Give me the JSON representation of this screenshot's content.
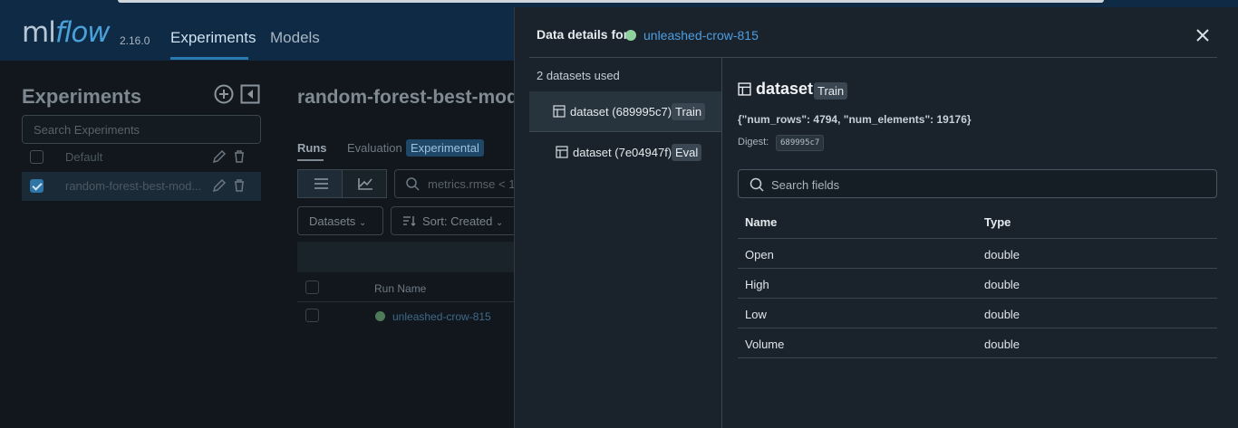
{
  "app": {
    "logo_ml": "ml",
    "logo_flow": "flow",
    "version": "2.16.0",
    "nav": [
      "Experiments",
      "Models"
    ]
  },
  "sidebar": {
    "title": "Experiments",
    "search_placeholder": "Search Experiments",
    "experiments": [
      {
        "name": "Default",
        "checked": false
      },
      {
        "name": "random-forest-best-mod...",
        "checked": true
      }
    ]
  },
  "main": {
    "title": "random-forest-best-mod",
    "tabs": [
      "Runs",
      "Evaluation"
    ],
    "experimental_badge": "Experimental",
    "search_text": "metrics.rmse < 1",
    "datasets_label": "Datasets",
    "sort_label": "Sort: Created",
    "column_run_name": "Run Name",
    "run_name": "unleashed-crow-815"
  },
  "drawer": {
    "header": "Data details for",
    "run_name": "unleashed-crow-815",
    "datasets_used": "2 datasets used",
    "datasets": [
      {
        "name": "dataset (689995c7)",
        "tag": "Train",
        "selected": true
      },
      {
        "name": "dataset (7e04947f)",
        "tag": "Eval",
        "selected": false
      }
    ],
    "detail": {
      "title": "dataset",
      "tag": "Train",
      "profile": "{\"num_rows\": 4794, \"num_elements\": 19176}",
      "digest_label": "Digest:",
      "digest": "689995c7",
      "search_placeholder": "Search fields",
      "columns": [
        "Name",
        "Type"
      ],
      "fields": [
        {
          "name": "Open",
          "type": "double"
        },
        {
          "name": "High",
          "type": "double"
        },
        {
          "name": "Low",
          "type": "double"
        },
        {
          "name": "Volume",
          "type": "double"
        }
      ]
    }
  },
  "colors": {
    "accent": "#4c9ee3",
    "run_dot": "#8fd19e"
  }
}
